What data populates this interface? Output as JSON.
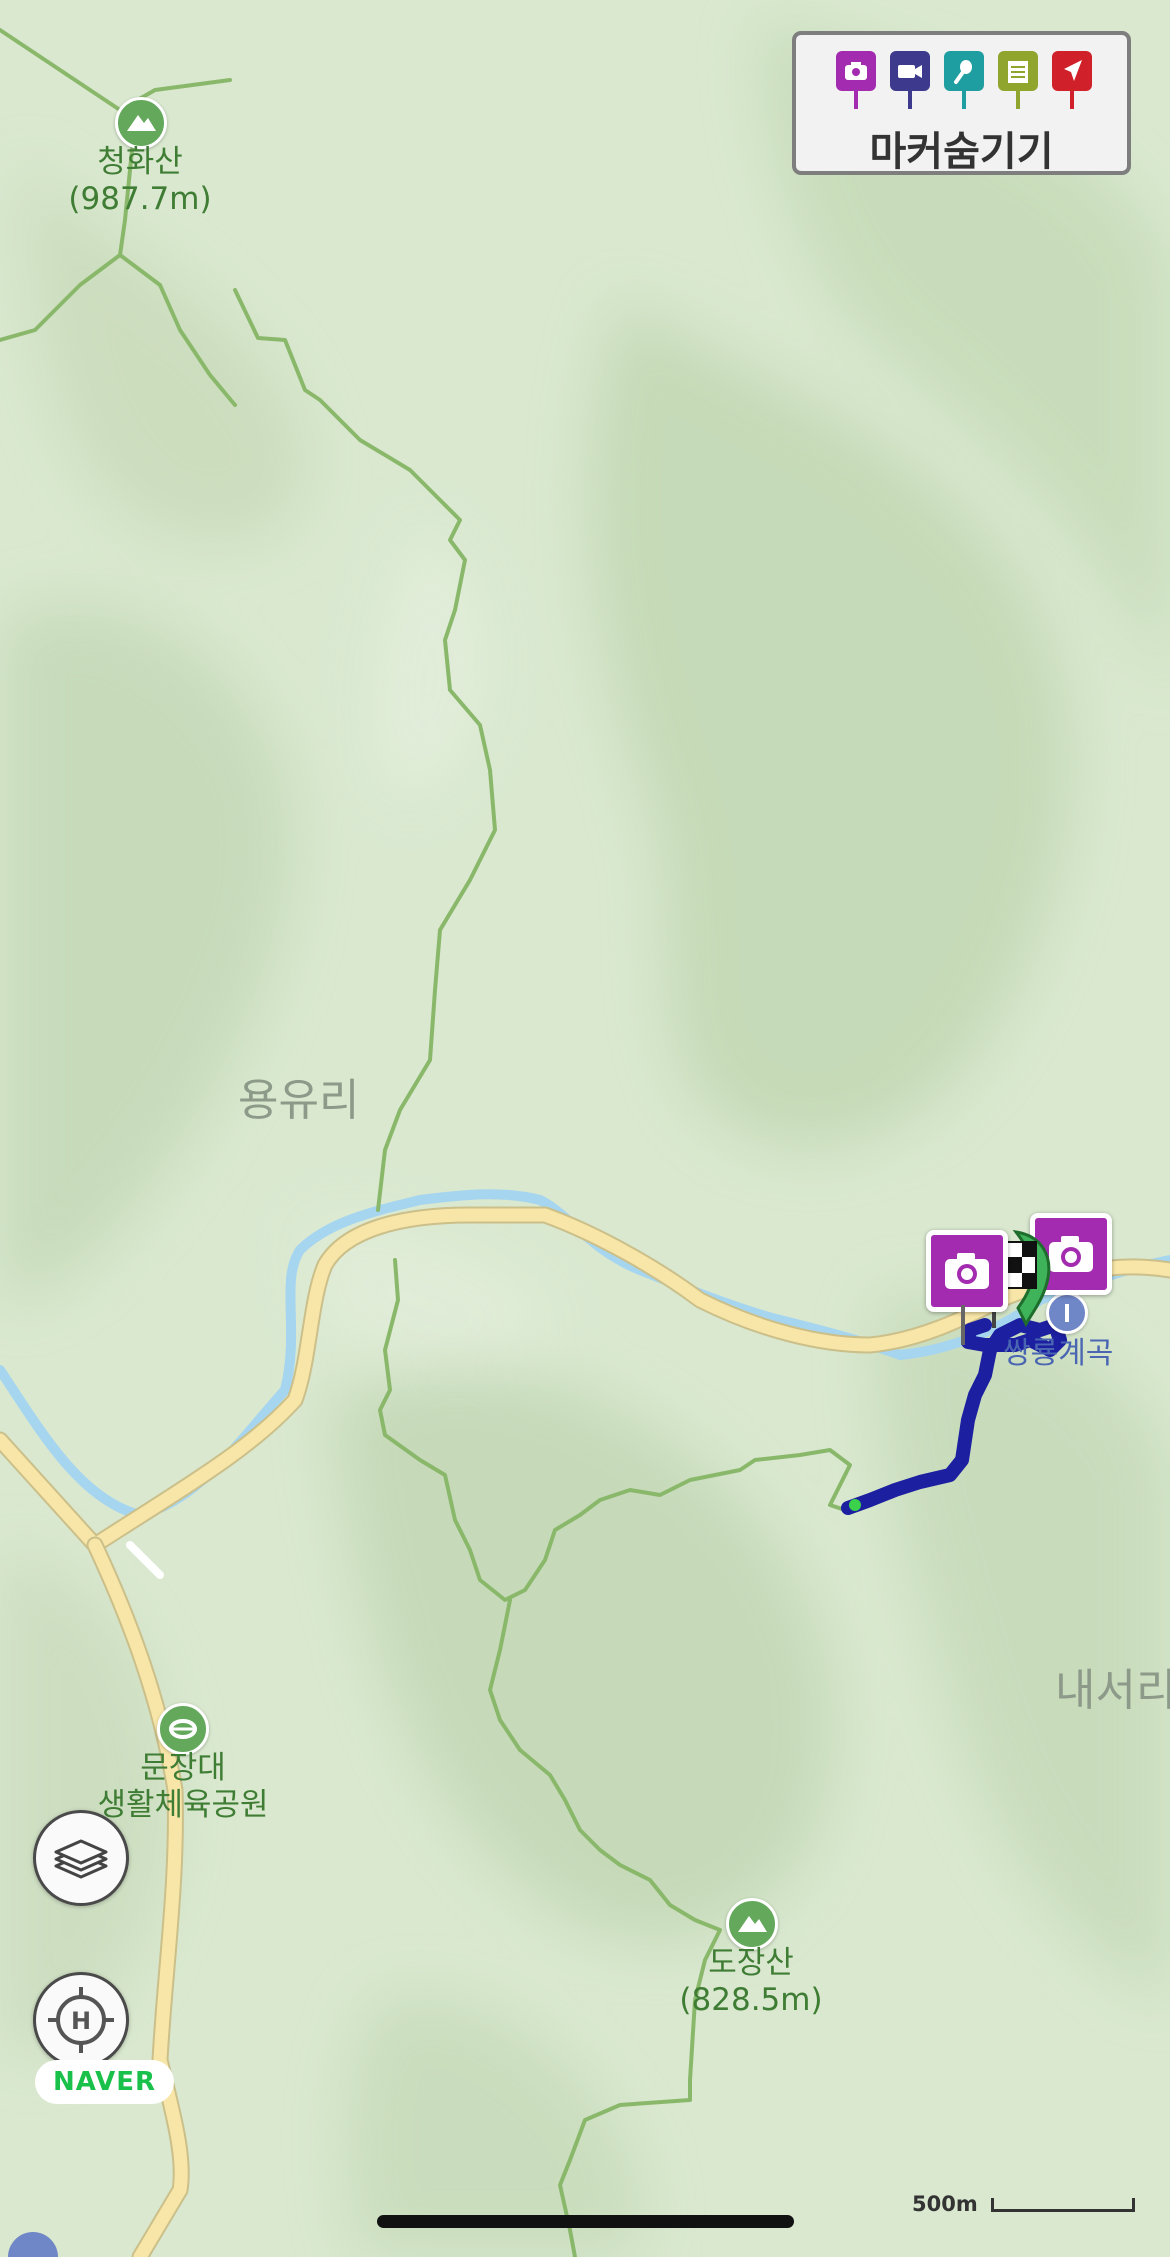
{
  "marker_panel": {
    "label": "마커숨기기",
    "marker_types": [
      {
        "icon": "camera-icon",
        "color": "#a32bb0"
      },
      {
        "icon": "video-icon",
        "color": "#3d3a8e"
      },
      {
        "icon": "microphone-icon",
        "color": "#1f9ea1"
      },
      {
        "icon": "memo-icon",
        "color": "#8fa52e"
      },
      {
        "icon": "location-arrow-icon",
        "color": "#d0202a"
      }
    ]
  },
  "places": {
    "peak_cheonghwa": {
      "name": "청화산",
      "elevation": "(987.7m)"
    },
    "village_yongyu": {
      "name": "용유리"
    },
    "valley_ssangyong": {
      "name": "쌍룡계곡"
    },
    "village_naeseo": {
      "name": "내서리"
    },
    "park_munjangdae": {
      "name": "문장대",
      "name_line2": "생활체육공원"
    },
    "peak_dojang": {
      "name": "도장산",
      "elevation": "(828.5m)"
    }
  },
  "markers": [
    {
      "type": "photo",
      "icon": "camera-icon"
    },
    {
      "type": "photo",
      "icon": "camera-icon"
    },
    {
      "type": "finish",
      "icon": "checkered-flag-icon"
    }
  ],
  "track": {
    "color": "#1c1fa0",
    "start_color": "#3bd14a"
  },
  "controls": {
    "layers_icon": "layers-icon",
    "location_icon": "crosshair-heading-icon",
    "logo": "NAVER"
  },
  "scale": {
    "label": "500m"
  },
  "colors": {
    "land": "#d9e8cf",
    "river": "#a6d5f0",
    "road": "#f8e6a8",
    "trail": "#8ab86b"
  }
}
